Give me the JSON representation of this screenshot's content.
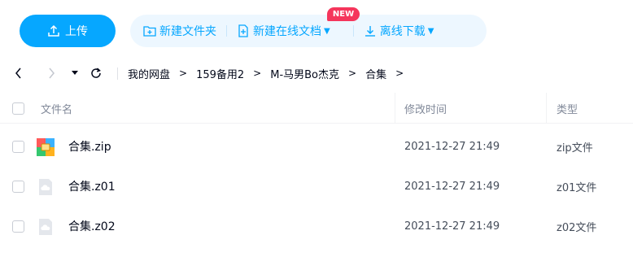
{
  "toolbar": {
    "upload_label": "上传",
    "new_folder_label": "新建文件夹",
    "new_online_doc_label": "新建在线文档",
    "new_badge": "NEW",
    "offline_download_label": "离线下载"
  },
  "breadcrumb": {
    "items": [
      "我的网盘",
      "159备用2",
      "M-马男Bo杰克",
      "合集"
    ],
    "separator": ">"
  },
  "table": {
    "columns": {
      "name": "文件名",
      "modified": "修改时间",
      "type": "类型"
    },
    "rows": [
      {
        "name": "合集.zip",
        "modified": "2021-12-27 21:49",
        "type": "zip文件",
        "icon": "zip-archive-icon"
      },
      {
        "name": "合集.z01",
        "modified": "2021-12-27 21:49",
        "type": "z01文件",
        "icon": "unknown-file-icon"
      },
      {
        "name": "合集.z02",
        "modified": "2021-12-27 21:49",
        "type": "z02文件",
        "icon": "unknown-file-icon"
      }
    ]
  },
  "colors": {
    "accent": "#06a7ff",
    "action_bg": "#edf7ff",
    "badge": "#f5365c",
    "muted_text": "#818999"
  }
}
